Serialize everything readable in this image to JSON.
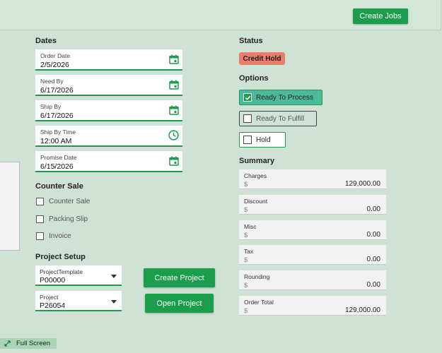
{
  "header": {
    "create_jobs_label": "Create Jobs"
  },
  "dates": {
    "title": "Dates",
    "fields": [
      {
        "label": "Order Date",
        "value": "2/5/2026",
        "icon": "calendar-icon"
      },
      {
        "label": "Need By",
        "value": "6/17/2026",
        "icon": "calendar-icon"
      },
      {
        "label": "Ship By",
        "value": "6/17/2026",
        "icon": "calendar-icon"
      },
      {
        "label": "Ship By Time",
        "value": "12:00 AM",
        "icon": "clock-icon"
      },
      {
        "label": "Promise Date",
        "value": "6/15/2026",
        "icon": "calendar-icon"
      }
    ]
  },
  "counter_sale": {
    "title": "Counter Sale",
    "options": [
      {
        "label": "Counter Sale",
        "checked": false
      },
      {
        "label": "Packing Slip",
        "checked": false
      },
      {
        "label": "Invoice",
        "checked": false
      }
    ]
  },
  "project_setup": {
    "title": "Project Setup",
    "template": {
      "label": "ProjectTemplate",
      "value": "P00000"
    },
    "project": {
      "label": "Project",
      "value": "P26054"
    },
    "create_label": "Create Project",
    "open_label": "Open Project"
  },
  "status": {
    "title": "Status",
    "badge": "Credit Hold",
    "badge_color": "#f07b6b"
  },
  "options": {
    "title": "Options",
    "items": [
      {
        "label": "Ready To Process",
        "checked": true
      },
      {
        "label": "Ready To Fulfill",
        "checked": false
      },
      {
        "label": "Hold",
        "checked": false
      }
    ]
  },
  "summary": {
    "title": "Summary",
    "currency": "$",
    "rows": [
      {
        "label": "Charges",
        "amount": "129,000.00"
      },
      {
        "label": "Discount",
        "amount": "0.00"
      },
      {
        "label": "Misc",
        "amount": "0.00"
      },
      {
        "label": "Tax",
        "amount": "0.00"
      },
      {
        "label": "Rounding",
        "amount": "0.00"
      },
      {
        "label": "Order Total",
        "amount": "129,000.00"
      }
    ]
  },
  "footer": {
    "full_screen_label": "Full Screen"
  },
  "colors": {
    "accent": "#1a9e4b",
    "background": "#cfe2d5"
  }
}
